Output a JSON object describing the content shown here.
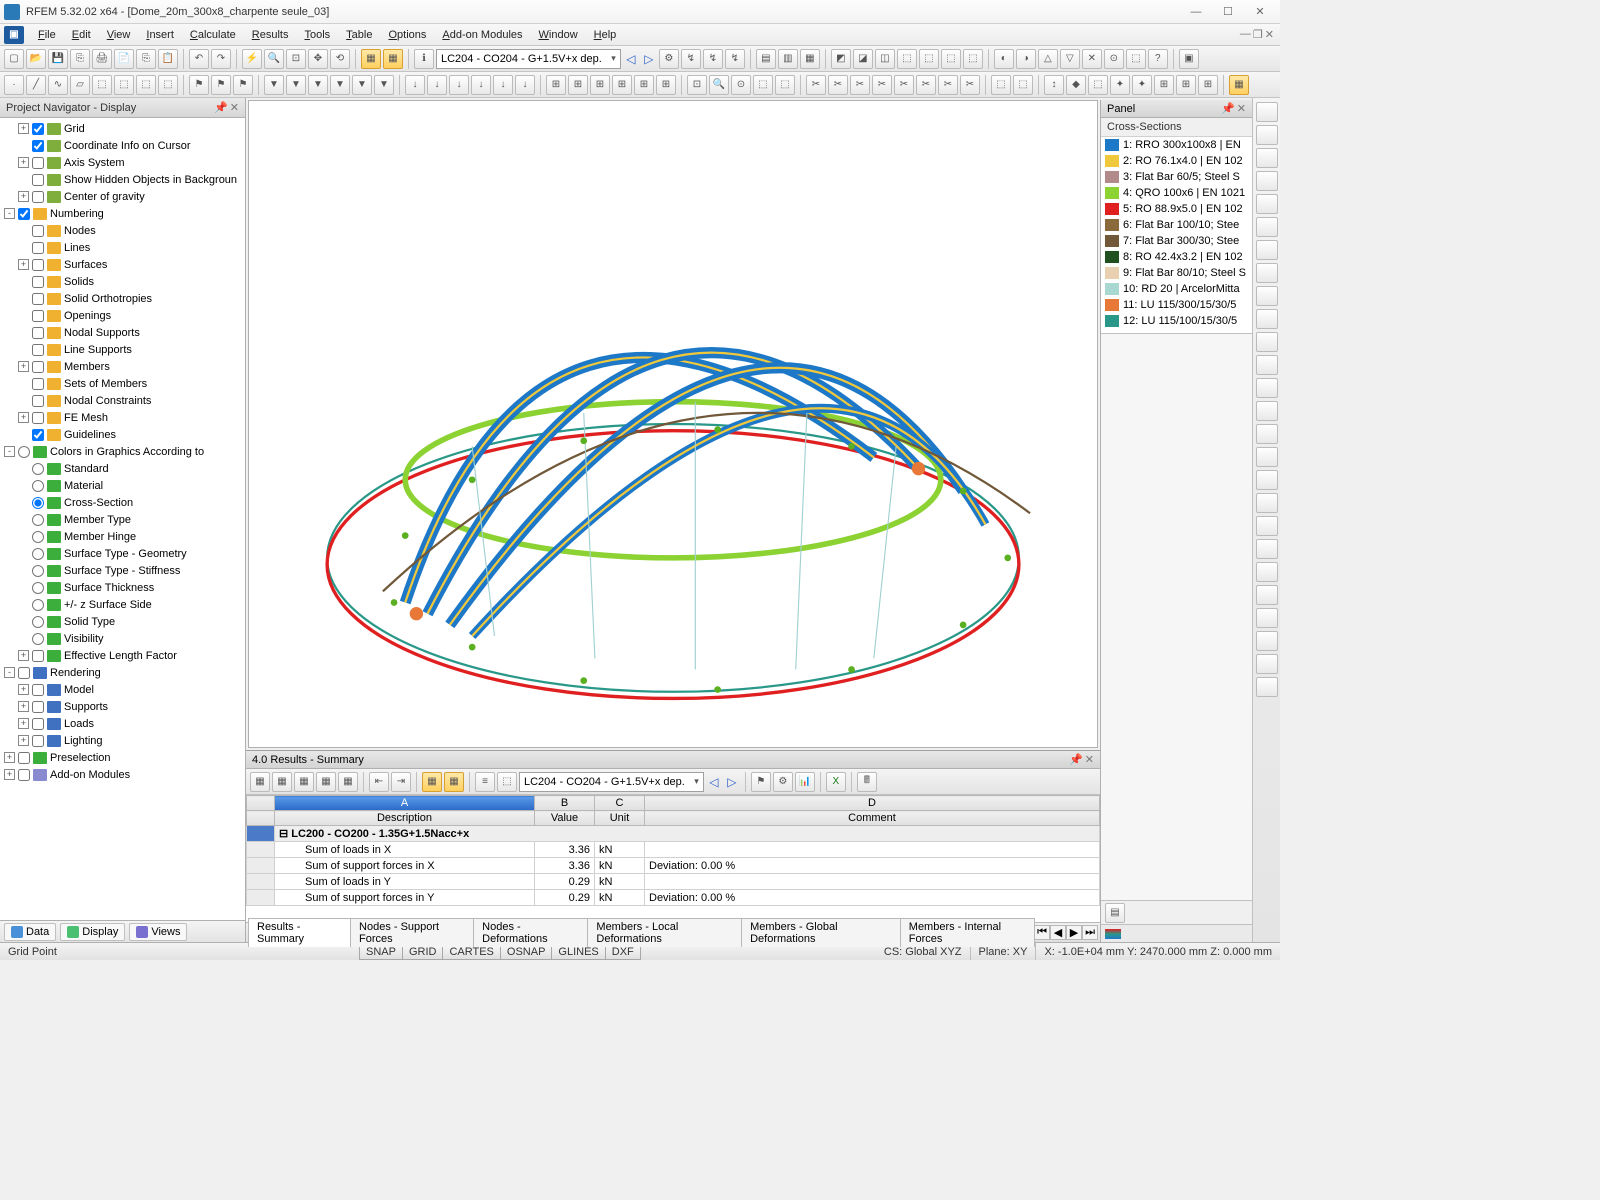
{
  "title": "RFEM 5.32.02 x64 - [Dome_20m_300x8_charpente seule_03]",
  "menus": [
    "File",
    "Edit",
    "View",
    "Insert",
    "Calculate",
    "Results",
    "Tools",
    "Table",
    "Options",
    "Add-on Modules",
    "Window",
    "Help"
  ],
  "loadcase": "LC204 - CO204 - G+1.5V+x dep.",
  "navigator": {
    "title": "Project Navigator - Display",
    "items": [
      {
        "type": "chk",
        "exp": "+",
        "icon": "ic-grid",
        "lbl": "Grid",
        "ind": 1,
        "ck": true
      },
      {
        "type": "chk",
        "exp": " ",
        "icon": "ic-grid",
        "lbl": "Coordinate Info on Cursor",
        "ind": 1,
        "ck": true
      },
      {
        "type": "chk",
        "exp": "+",
        "icon": "ic-grid",
        "lbl": "Axis System",
        "ind": 1,
        "ck": false
      },
      {
        "type": "chk",
        "exp": " ",
        "icon": "ic-grid",
        "lbl": "Show Hidden Objects in Backgroun",
        "ind": 1,
        "ck": false
      },
      {
        "type": "chk",
        "exp": "+",
        "icon": "ic-grid",
        "lbl": "Center of gravity",
        "ind": 1,
        "ck": false
      },
      {
        "type": "chk",
        "exp": "-",
        "icon": "ic-num",
        "lbl": "Numbering",
        "ind": 0,
        "ck": true
      },
      {
        "type": "chk",
        "exp": " ",
        "icon": "ic-num",
        "lbl": "Nodes",
        "ind": 1,
        "ck": false
      },
      {
        "type": "chk",
        "exp": " ",
        "icon": "ic-num",
        "lbl": "Lines",
        "ind": 1,
        "ck": false
      },
      {
        "type": "chk",
        "exp": "+",
        "icon": "ic-num",
        "lbl": "Surfaces",
        "ind": 1,
        "ck": false
      },
      {
        "type": "chk",
        "exp": " ",
        "icon": "ic-num",
        "lbl": "Solids",
        "ind": 1,
        "ck": false
      },
      {
        "type": "chk",
        "exp": " ",
        "icon": "ic-num",
        "lbl": "Solid Orthotropies",
        "ind": 1,
        "ck": false
      },
      {
        "type": "chk",
        "exp": " ",
        "icon": "ic-num",
        "lbl": "Openings",
        "ind": 1,
        "ck": false
      },
      {
        "type": "chk",
        "exp": " ",
        "icon": "ic-num",
        "lbl": "Nodal Supports",
        "ind": 1,
        "ck": false
      },
      {
        "type": "chk",
        "exp": " ",
        "icon": "ic-num",
        "lbl": "Line Supports",
        "ind": 1,
        "ck": false
      },
      {
        "type": "chk",
        "exp": "+",
        "icon": "ic-num",
        "lbl": "Members",
        "ind": 1,
        "ck": false
      },
      {
        "type": "chk",
        "exp": " ",
        "icon": "ic-num",
        "lbl": "Sets of Members",
        "ind": 1,
        "ck": false
      },
      {
        "type": "chk",
        "exp": " ",
        "icon": "ic-num",
        "lbl": "Nodal Constraints",
        "ind": 1,
        "ck": false
      },
      {
        "type": "chk",
        "exp": "+",
        "icon": "ic-num",
        "lbl": "FE Mesh",
        "ind": 1,
        "ck": false
      },
      {
        "type": "chk",
        "exp": " ",
        "icon": "ic-num",
        "lbl": "Guidelines",
        "ind": 1,
        "ck": true
      },
      {
        "type": "rad",
        "exp": "-",
        "icon": "ic-col",
        "lbl": "Colors in Graphics According to",
        "ind": 0,
        "ck": false,
        "hdr": true
      },
      {
        "type": "rad",
        "exp": " ",
        "icon": "ic-col",
        "lbl": "Standard",
        "ind": 1,
        "ck": false
      },
      {
        "type": "rad",
        "exp": " ",
        "icon": "ic-col",
        "lbl": "Material",
        "ind": 1,
        "ck": false
      },
      {
        "type": "rad",
        "exp": " ",
        "icon": "ic-col",
        "lbl": "Cross-Section",
        "ind": 1,
        "ck": true
      },
      {
        "type": "rad",
        "exp": " ",
        "icon": "ic-col",
        "lbl": "Member Type",
        "ind": 1,
        "ck": false
      },
      {
        "type": "rad",
        "exp": " ",
        "icon": "ic-col",
        "lbl": "Member Hinge",
        "ind": 1,
        "ck": false
      },
      {
        "type": "rad",
        "exp": " ",
        "icon": "ic-col",
        "lbl": "Surface Type - Geometry",
        "ind": 1,
        "ck": false
      },
      {
        "type": "rad",
        "exp": " ",
        "icon": "ic-col",
        "lbl": "Surface Type - Stiffness",
        "ind": 1,
        "ck": false
      },
      {
        "type": "rad",
        "exp": " ",
        "icon": "ic-col",
        "lbl": "Surface Thickness",
        "ind": 1,
        "ck": false
      },
      {
        "type": "rad",
        "exp": " ",
        "icon": "ic-col",
        "lbl": "+/- z Surface Side",
        "ind": 1,
        "ck": false
      },
      {
        "type": "rad",
        "exp": " ",
        "icon": "ic-col",
        "lbl": "Solid Type",
        "ind": 1,
        "ck": false
      },
      {
        "type": "rad",
        "exp": " ",
        "icon": "ic-col",
        "lbl": "Visibility",
        "ind": 1,
        "ck": false
      },
      {
        "type": "chk",
        "exp": "+",
        "icon": "ic-col",
        "lbl": "Effective Length Factor",
        "ind": 1,
        "ck": false
      },
      {
        "type": "chk",
        "exp": "-",
        "icon": "ic-ren",
        "lbl": "Rendering",
        "ind": 0,
        "ck": false,
        "hdr": true
      },
      {
        "type": "chk",
        "exp": "+",
        "icon": "ic-ren",
        "lbl": "Model",
        "ind": 1,
        "ck": false,
        "sq": true
      },
      {
        "type": "chk",
        "exp": "+",
        "icon": "ic-ren",
        "lbl": "Supports",
        "ind": 1,
        "ck": false,
        "sq": true
      },
      {
        "type": "chk",
        "exp": "+",
        "icon": "ic-ren",
        "lbl": "Loads",
        "ind": 1,
        "ck": false,
        "sq": true
      },
      {
        "type": "chk",
        "exp": "+",
        "icon": "ic-ren",
        "lbl": "Lighting",
        "ind": 1,
        "ck": false,
        "sq": true
      },
      {
        "type": "chk",
        "exp": "+",
        "icon": "ic-col",
        "lbl": "Preselection",
        "ind": 0,
        "ck": false,
        "sq": true
      },
      {
        "type": "chk",
        "exp": "+",
        "icon": "ic-mod",
        "lbl": "Add-on Modules",
        "ind": 0,
        "ck": false,
        "sq": true
      }
    ],
    "tabs": [
      "Data",
      "Display",
      "Views"
    ]
  },
  "panel": {
    "title": "Panel",
    "subtitle": "Cross-Sections",
    "items": [
      {
        "c": "#1e78c8",
        "t": "1: RRO 300x100x8 | EN"
      },
      {
        "c": "#f0c83c",
        "t": "2: RO 76.1x4.0 | EN 102"
      },
      {
        "c": "#b28a8a",
        "t": "3: Flat Bar 60/5; Steel S"
      },
      {
        "c": "#8cd232",
        "t": "4: QRO 100x6 | EN 1021"
      },
      {
        "c": "#e02020",
        "t": "5: RO 88.9x5.0 | EN 102"
      },
      {
        "c": "#8a6a3a",
        "t": "6: Flat Bar 100/10; Stee"
      },
      {
        "c": "#705838",
        "t": "7: Flat Bar 300/30; Stee"
      },
      {
        "c": "#205020",
        "t": "8: RO 42.4x3.2 | EN 102"
      },
      {
        "c": "#e8d0b0",
        "t": "9: Flat Bar 80/10; Steel S"
      },
      {
        "c": "#a8d8d0",
        "t": "10: RD 20 | ArcelorMitta"
      },
      {
        "c": "#e87838",
        "t": "11: LU 115/300/15/30/5"
      },
      {
        "c": "#2a9888",
        "t": "12: LU 115/100/15/30/5"
      }
    ]
  },
  "results": {
    "title": "4.0 Results - Summary",
    "combo": "LC204 - CO204 - G+1.5V+x dep.",
    "cols": [
      "A",
      "B",
      "C",
      "D"
    ],
    "hdrs": [
      "Description",
      "Value",
      "Unit",
      "Comment"
    ],
    "grp": "LC200 - CO200 - 1.35G+1.5Nacc+x",
    "rows": [
      {
        "d": "Sum of loads in X",
        "v": "3.36",
        "u": "kN",
        "c": ""
      },
      {
        "d": "Sum of support forces in X",
        "v": "3.36",
        "u": "kN",
        "c": "Deviation:  0.00 %"
      },
      {
        "d": "Sum of loads in Y",
        "v": "0.29",
        "u": "kN",
        "c": ""
      },
      {
        "d": "Sum of support forces in Y",
        "v": "0.29",
        "u": "kN",
        "c": "Deviation:  0.00 %"
      }
    ],
    "tabs": [
      "Results - Summary",
      "Nodes - Support Forces",
      "Nodes - Deformations",
      "Members - Local Deformations",
      "Members - Global Deformations",
      "Members - Internal Forces"
    ]
  },
  "status": {
    "left": "Grid Point",
    "btns": [
      "SNAP",
      "GRID",
      "CARTES",
      "OSNAP",
      "GLINES",
      "DXF"
    ],
    "cs": "CS: Global XYZ",
    "plane": "Plane: XY",
    "coords": "X: -1.0E+04 mm Y:  2470.000 mm Z:  0.000 mm"
  }
}
